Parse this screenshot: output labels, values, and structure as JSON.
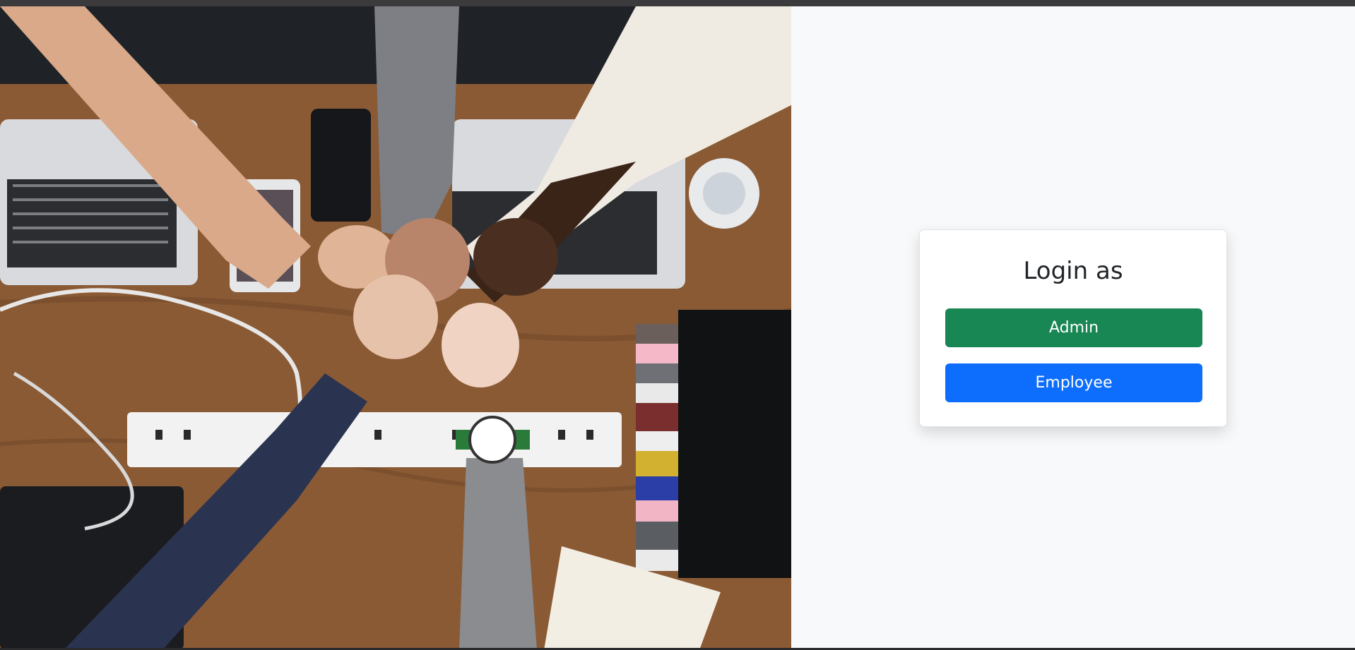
{
  "login": {
    "title": "Login as",
    "admin_label": "Admin",
    "employee_label": "Employee"
  },
  "hero": {
    "description": "Team fist bump over desk with laptops",
    "icon": "hero-photo"
  },
  "colors": {
    "admin": "#198754",
    "employee": "#0d6efd",
    "background": "#f8f9fa"
  }
}
